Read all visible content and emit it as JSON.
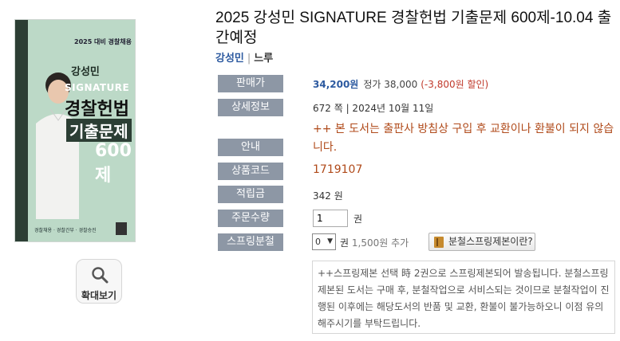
{
  "book": {
    "title": "2025 강성민 SIGNATURE 경찰헌법 기출문제 600제-10.04 출간예정",
    "author": "강성민",
    "separator": "|",
    "publisher": "느루"
  },
  "cover": {
    "series": "2025 대비 경찰채용",
    "author": "강성민",
    "brand": "SIGNATURE",
    "title_line1": "경찰헌법",
    "title_line2": "기출문제",
    "count": "600제",
    "footer": "경찰채용 · 경찰간부 · 경찰승진"
  },
  "zoom": {
    "label": "확대보기"
  },
  "labels": {
    "price": "판매가",
    "detail": "상세정보",
    "notice": "안내",
    "code": "상품코드",
    "points": "적립금",
    "qty": "주문수량",
    "spring": "스프링분철"
  },
  "values": {
    "sale_price": "34,200원",
    "list_price": "정가 38,000",
    "discount": "(-3,800원 할인)",
    "detail": "672 쪽  |  2024년 10월 11일",
    "notice": "++ 본 도서는 출판사 방침상 구입 후 교환이나 환불이 되지 않습니다.",
    "code": "1719107",
    "points": "342 원",
    "qty_value": "1",
    "qty_unit": "권",
    "spring_selected": "0",
    "spring_unit": "권",
    "spring_price": "1,500원 추가",
    "spring_button": "분철스프링제본이란?"
  },
  "spring_info": "++스프링제본 선택 時 2권으로 스프링제본되어 발송됩니다. 분철스프링제본된 도서는 구매 후, 분철작업으로 서비스되는 것이므로 분철작업이 진행된 이후에는 해당도서의 반품 및 교환, 환불이 불가능하오니 이점 유의해주시기를 부탁드립니다.",
  "colors": {
    "label_bg": "#8d97a5",
    "price_blue": "#2d5aa0",
    "discount_red": "#c0392b",
    "notice_orange": "#b04a1a",
    "cover_green": "#bcd9c7"
  }
}
